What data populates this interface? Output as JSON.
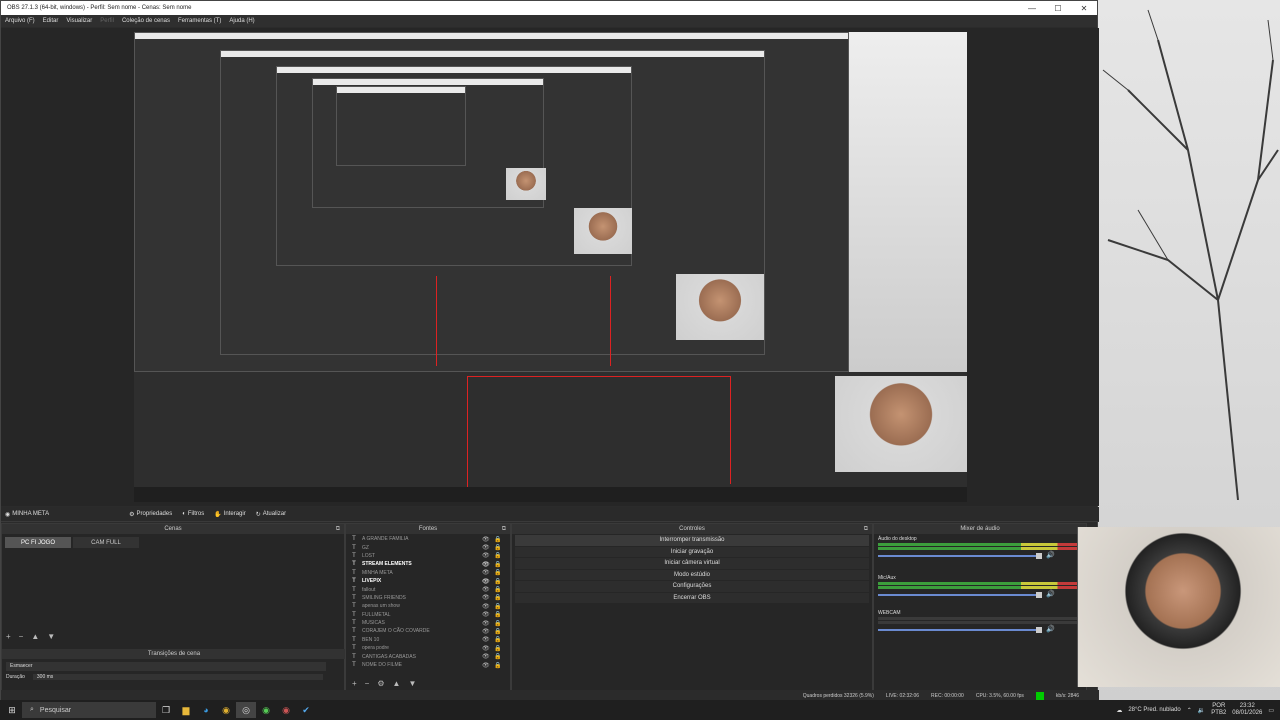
{
  "window": {
    "title": "OBS 27.1.3 (64-bit, windows) - Perfil: Sem nome - Cenas: Sem nome",
    "controls": [
      "—",
      "☐",
      "✕"
    ]
  },
  "menu": {
    "items": [
      "Arquivo (F)",
      "Editar",
      "Visualizar",
      "Perfil",
      "Coleção de cenas",
      "Ferramentas (T)",
      "Ajuda (H)"
    ]
  },
  "context_bar": {
    "scene_name": "MINHA META",
    "properties": "Propriedades",
    "filters": "Filtros",
    "interact": "Interagir",
    "refresh": "Atualizar"
  },
  "scenes": {
    "title": "Cenas",
    "items": [
      {
        "label": "PC FI JOGO",
        "active": true
      },
      {
        "label": "CAM FULL",
        "active": false
      }
    ]
  },
  "transitions": {
    "title": "Transições de cena",
    "type": "Esmaecer",
    "duration_label": "Duração",
    "duration_value": "300 ms"
  },
  "sources": {
    "title": "Fontes",
    "items": [
      {
        "label": "A GRANDE FAMILIA",
        "bold": false
      },
      {
        "label": "GZ",
        "bold": false
      },
      {
        "label": "LOST",
        "bold": false
      },
      {
        "label": "STREAM ELEMENTS",
        "bold": true
      },
      {
        "label": "MINHA META",
        "bold": false
      },
      {
        "label": "LIVEPIX",
        "bold": true
      },
      {
        "label": "fallout",
        "bold": false
      },
      {
        "label": "SMILING FRIENDS",
        "bold": false
      },
      {
        "label": "apenas um show",
        "bold": false
      },
      {
        "label": "FULLMETAL",
        "bold": false
      },
      {
        "label": "MUSICAS",
        "bold": false
      },
      {
        "label": "CORAJEM O CÃO COVARDE",
        "bold": false
      },
      {
        "label": "BEN 10",
        "bold": false
      },
      {
        "label": "opera podre",
        "bold": false
      },
      {
        "label": "CANTIGAS ACABADAS",
        "bold": false
      },
      {
        "label": "NOME DO FILME",
        "bold": false
      }
    ]
  },
  "controls": {
    "title": "Controles",
    "buttons": [
      "Interromper transmissão",
      "Iniciar gravação",
      "Iniciar câmera virtual",
      "Modo estúdio",
      "Configurações",
      "Encerrar OBS"
    ]
  },
  "mixer": {
    "title": "Mixer de áudio",
    "channels": [
      {
        "name": "Áudio do desktop"
      },
      {
        "name": "Mic/Aux"
      },
      {
        "name": "WEBCAM"
      }
    ]
  },
  "status": {
    "dropped": "Quadros perdidos 32326 (5.9%)",
    "live": "LIVE: 02:32:06",
    "rec": "REC: 00:00:00",
    "cpu": "CPU: 3.5%, 60.00 fps",
    "kbps": "kb/s: 2846"
  },
  "taskbar": {
    "search_placeholder": "Pesquisar",
    "weather": "28°C Pred. nublado",
    "lang": "POR",
    "layout": "PTB2",
    "time": "23:32",
    "date": "08/01/2026"
  },
  "colors": {
    "accent_red": "#dd2222",
    "live_green": "#00cc00",
    "meter_green": "#3c9e3c"
  }
}
